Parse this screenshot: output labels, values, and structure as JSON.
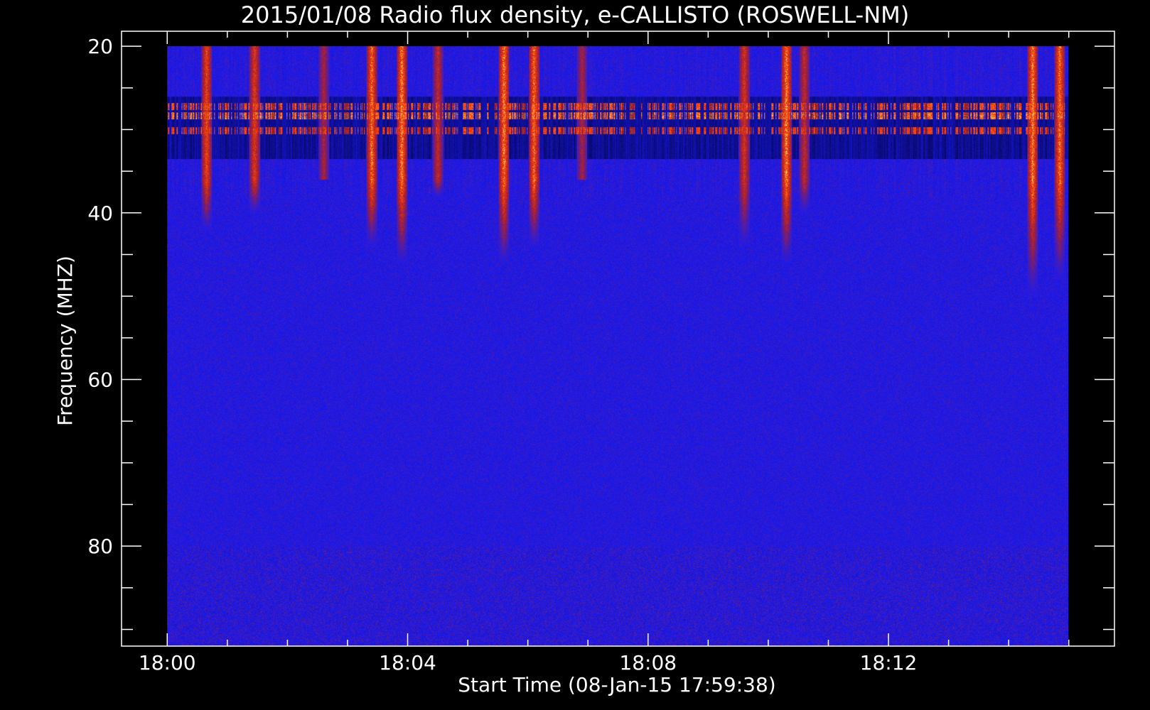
{
  "chart_data": {
    "type": "heatmap",
    "title": "2015/01/08  Radio flux density, e-CALLISTO (ROSWELL-NM)",
    "xlabel": "Start Time (08-Jan-15 17:59:38)",
    "ylabel": "Frequency (MHZ)",
    "x_major_ticks": [
      {
        "label": "18:00",
        "minutes": 0
      },
      {
        "label": "18:04",
        "minutes": 4
      },
      {
        "label": "18:08",
        "minutes": 8
      },
      {
        "label": "18:12",
        "minutes": 12
      }
    ],
    "x_minor_step_minutes": 1,
    "x_axis_range_minutes": [
      -0.76,
      15.76
    ],
    "data_time_range_minutes": [
      0,
      15
    ],
    "y_major_ticks": [
      {
        "label": "20",
        "value": 20
      },
      {
        "label": "40",
        "value": 40
      },
      {
        "label": "60",
        "value": 60
      },
      {
        "label": "80",
        "value": 80
      }
    ],
    "y_minor_step": 5,
    "y_axis_range_mhz": [
      18.2,
      92
    ],
    "data_freq_range_mhz": [
      20,
      92
    ],
    "y_inverted": true,
    "colormap": {
      "background": "#1a1af0",
      "low": "#000033",
      "mid": "#b02010",
      "high": "#ffff60"
    },
    "bright_bands_mhz": [
      {
        "freq": 27.2,
        "intensity": 0.75
      },
      {
        "freq": 28.3,
        "intensity": 0.85
      },
      {
        "freq": 30.1,
        "intensity": 0.7
      }
    ],
    "dark_band_mhz": [
      26.0,
      33.5
    ],
    "bursts": [
      {
        "time_min": 0.65,
        "intensity": 0.7,
        "extent_mhz": 42
      },
      {
        "time_min": 1.45,
        "intensity": 0.65,
        "extent_mhz": 40
      },
      {
        "time_min": 2.6,
        "intensity": 0.4,
        "extent_mhz": 36
      },
      {
        "time_min": 3.4,
        "intensity": 0.85,
        "extent_mhz": 44
      },
      {
        "time_min": 3.9,
        "intensity": 0.9,
        "extent_mhz": 46
      },
      {
        "time_min": 4.5,
        "intensity": 0.5,
        "extent_mhz": 38
      },
      {
        "time_min": 5.6,
        "intensity": 0.9,
        "extent_mhz": 46
      },
      {
        "time_min": 6.1,
        "intensity": 0.85,
        "extent_mhz": 44
      },
      {
        "time_min": 6.9,
        "intensity": 0.4,
        "extent_mhz": 36
      },
      {
        "time_min": 9.6,
        "intensity": 0.6,
        "extent_mhz": 44
      },
      {
        "time_min": 10.3,
        "intensity": 0.9,
        "extent_mhz": 46
      },
      {
        "time_min": 10.6,
        "intensity": 0.5,
        "extent_mhz": 40
      },
      {
        "time_min": 14.4,
        "intensity": 0.9,
        "extent_mhz": 50
      },
      {
        "time_min": 14.85,
        "intensity": 0.85,
        "extent_mhz": 48
      }
    ]
  }
}
